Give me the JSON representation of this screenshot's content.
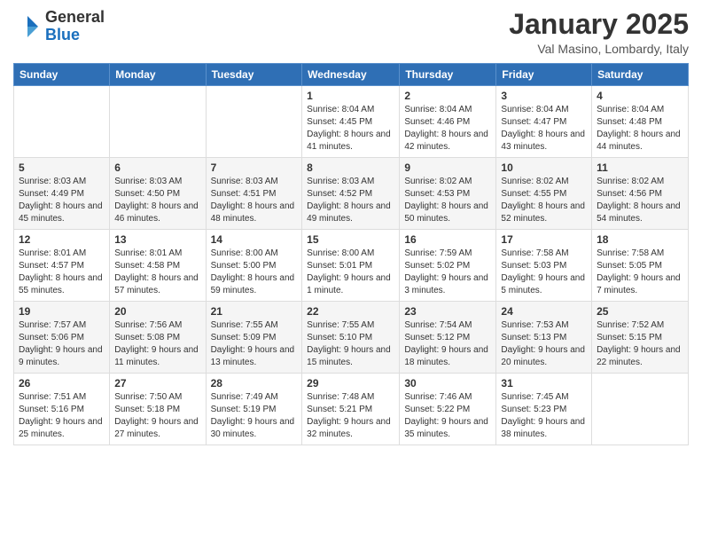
{
  "header": {
    "logo_general": "General",
    "logo_blue": "Blue",
    "month_title": "January 2025",
    "location": "Val Masino, Lombardy, Italy"
  },
  "weekdays": [
    "Sunday",
    "Monday",
    "Tuesday",
    "Wednesday",
    "Thursday",
    "Friday",
    "Saturday"
  ],
  "weeks": [
    [
      {
        "day": "",
        "info": ""
      },
      {
        "day": "",
        "info": ""
      },
      {
        "day": "",
        "info": ""
      },
      {
        "day": "1",
        "info": "Sunrise: 8:04 AM\nSunset: 4:45 PM\nDaylight: 8 hours and 41 minutes."
      },
      {
        "day": "2",
        "info": "Sunrise: 8:04 AM\nSunset: 4:46 PM\nDaylight: 8 hours and 42 minutes."
      },
      {
        "day": "3",
        "info": "Sunrise: 8:04 AM\nSunset: 4:47 PM\nDaylight: 8 hours and 43 minutes."
      },
      {
        "day": "4",
        "info": "Sunrise: 8:04 AM\nSunset: 4:48 PM\nDaylight: 8 hours and 44 minutes."
      }
    ],
    [
      {
        "day": "5",
        "info": "Sunrise: 8:03 AM\nSunset: 4:49 PM\nDaylight: 8 hours and 45 minutes."
      },
      {
        "day": "6",
        "info": "Sunrise: 8:03 AM\nSunset: 4:50 PM\nDaylight: 8 hours and 46 minutes."
      },
      {
        "day": "7",
        "info": "Sunrise: 8:03 AM\nSunset: 4:51 PM\nDaylight: 8 hours and 48 minutes."
      },
      {
        "day": "8",
        "info": "Sunrise: 8:03 AM\nSunset: 4:52 PM\nDaylight: 8 hours and 49 minutes."
      },
      {
        "day": "9",
        "info": "Sunrise: 8:02 AM\nSunset: 4:53 PM\nDaylight: 8 hours and 50 minutes."
      },
      {
        "day": "10",
        "info": "Sunrise: 8:02 AM\nSunset: 4:55 PM\nDaylight: 8 hours and 52 minutes."
      },
      {
        "day": "11",
        "info": "Sunrise: 8:02 AM\nSunset: 4:56 PM\nDaylight: 8 hours and 54 minutes."
      }
    ],
    [
      {
        "day": "12",
        "info": "Sunrise: 8:01 AM\nSunset: 4:57 PM\nDaylight: 8 hours and 55 minutes."
      },
      {
        "day": "13",
        "info": "Sunrise: 8:01 AM\nSunset: 4:58 PM\nDaylight: 8 hours and 57 minutes."
      },
      {
        "day": "14",
        "info": "Sunrise: 8:00 AM\nSunset: 5:00 PM\nDaylight: 8 hours and 59 minutes."
      },
      {
        "day": "15",
        "info": "Sunrise: 8:00 AM\nSunset: 5:01 PM\nDaylight: 9 hours and 1 minute."
      },
      {
        "day": "16",
        "info": "Sunrise: 7:59 AM\nSunset: 5:02 PM\nDaylight: 9 hours and 3 minutes."
      },
      {
        "day": "17",
        "info": "Sunrise: 7:58 AM\nSunset: 5:03 PM\nDaylight: 9 hours and 5 minutes."
      },
      {
        "day": "18",
        "info": "Sunrise: 7:58 AM\nSunset: 5:05 PM\nDaylight: 9 hours and 7 minutes."
      }
    ],
    [
      {
        "day": "19",
        "info": "Sunrise: 7:57 AM\nSunset: 5:06 PM\nDaylight: 9 hours and 9 minutes."
      },
      {
        "day": "20",
        "info": "Sunrise: 7:56 AM\nSunset: 5:08 PM\nDaylight: 9 hours and 11 minutes."
      },
      {
        "day": "21",
        "info": "Sunrise: 7:55 AM\nSunset: 5:09 PM\nDaylight: 9 hours and 13 minutes."
      },
      {
        "day": "22",
        "info": "Sunrise: 7:55 AM\nSunset: 5:10 PM\nDaylight: 9 hours and 15 minutes."
      },
      {
        "day": "23",
        "info": "Sunrise: 7:54 AM\nSunset: 5:12 PM\nDaylight: 9 hours and 18 minutes."
      },
      {
        "day": "24",
        "info": "Sunrise: 7:53 AM\nSunset: 5:13 PM\nDaylight: 9 hours and 20 minutes."
      },
      {
        "day": "25",
        "info": "Sunrise: 7:52 AM\nSunset: 5:15 PM\nDaylight: 9 hours and 22 minutes."
      }
    ],
    [
      {
        "day": "26",
        "info": "Sunrise: 7:51 AM\nSunset: 5:16 PM\nDaylight: 9 hours and 25 minutes."
      },
      {
        "day": "27",
        "info": "Sunrise: 7:50 AM\nSunset: 5:18 PM\nDaylight: 9 hours and 27 minutes."
      },
      {
        "day": "28",
        "info": "Sunrise: 7:49 AM\nSunset: 5:19 PM\nDaylight: 9 hours and 30 minutes."
      },
      {
        "day": "29",
        "info": "Sunrise: 7:48 AM\nSunset: 5:21 PM\nDaylight: 9 hours and 32 minutes."
      },
      {
        "day": "30",
        "info": "Sunrise: 7:46 AM\nSunset: 5:22 PM\nDaylight: 9 hours and 35 minutes."
      },
      {
        "day": "31",
        "info": "Sunrise: 7:45 AM\nSunset: 5:23 PM\nDaylight: 9 hours and 38 minutes."
      },
      {
        "day": "",
        "info": ""
      }
    ]
  ]
}
